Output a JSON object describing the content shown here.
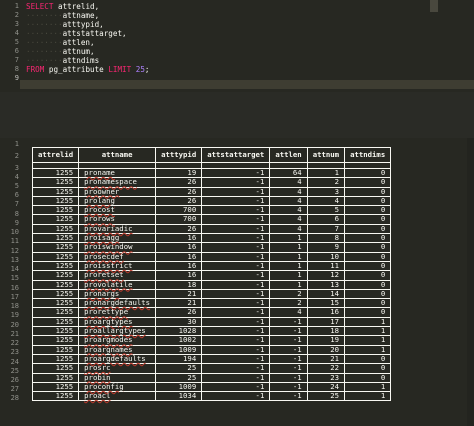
{
  "top_editor": {
    "line_numbers": [
      "1",
      "2",
      "3",
      "4",
      "5",
      "6",
      "7",
      "8",
      "9"
    ],
    "lines": [
      {
        "kw": "SELECT",
        "rest": " attrelid,"
      },
      {
        "rest": "attname,"
      },
      {
        "rest": "atttypid,"
      },
      {
        "rest": "attstattarget,"
      },
      {
        "rest": "attlen,"
      },
      {
        "rest": "attnum,"
      },
      {
        "rest": "attndims"
      },
      {
        "kw": "FROM",
        "rest": " pg_attribute ",
        "kw2": "LIMIT",
        "num": " 25",
        "end": ";"
      },
      {
        "rest": ""
      }
    ]
  },
  "bottom_editor": {
    "line_numbers": [
      "1",
      "2",
      "3",
      "4",
      "5",
      "6",
      "7",
      "8",
      "9",
      "10",
      "11",
      "12",
      "13",
      "14",
      "15",
      "16",
      "17",
      "18",
      "19",
      "20",
      "21",
      "22",
      "23",
      "24",
      "25",
      "26",
      "27",
      "28"
    ],
    "columns": [
      "attrelid",
      "attname",
      "atttypid",
      "attstattarget",
      "attlen",
      "attnum",
      "attndims"
    ],
    "rows": [
      [
        "1255",
        "proname",
        "19",
        "-1",
        "64",
        "1",
        "0"
      ],
      [
        "1255",
        "pronamespace",
        "26",
        "-1",
        "4",
        "2",
        "0"
      ],
      [
        "1255",
        "proowner",
        "26",
        "-1",
        "4",
        "3",
        "0"
      ],
      [
        "1255",
        "prolang",
        "26",
        "-1",
        "4",
        "4",
        "0"
      ],
      [
        "1255",
        "procost",
        "700",
        "-1",
        "4",
        "5",
        "0"
      ],
      [
        "1255",
        "prorows",
        "700",
        "-1",
        "4",
        "6",
        "0"
      ],
      [
        "1255",
        "provariadic",
        "26",
        "-1",
        "4",
        "7",
        "0"
      ],
      [
        "1255",
        "proisagg",
        "16",
        "-1",
        "1",
        "8",
        "0"
      ],
      [
        "1255",
        "proiswindow",
        "16",
        "-1",
        "1",
        "9",
        "0"
      ],
      [
        "1255",
        "prosecdef",
        "16",
        "-1",
        "1",
        "10",
        "0"
      ],
      [
        "1255",
        "proisstrict",
        "16",
        "-1",
        "1",
        "11",
        "0"
      ],
      [
        "1255",
        "proretset",
        "16",
        "-1",
        "1",
        "12",
        "0"
      ],
      [
        "1255",
        "provolatile",
        "18",
        "-1",
        "1",
        "13",
        "0"
      ],
      [
        "1255",
        "pronargs",
        "21",
        "-1",
        "2",
        "14",
        "0"
      ],
      [
        "1255",
        "pronargdefaults",
        "21",
        "-1",
        "2",
        "15",
        "0"
      ],
      [
        "1255",
        "prorettype",
        "26",
        "-1",
        "4",
        "16",
        "0"
      ],
      [
        "1255",
        "proargtypes",
        "30",
        "-1",
        "-1",
        "17",
        "1"
      ],
      [
        "1255",
        "proallargtypes",
        "1028",
        "-1",
        "-1",
        "18",
        "1"
      ],
      [
        "1255",
        "proargmodes",
        "1002",
        "-1",
        "-1",
        "19",
        "1"
      ],
      [
        "1255",
        "proargnames",
        "1009",
        "-1",
        "-1",
        "20",
        "1"
      ],
      [
        "1255",
        "proargdefaults",
        "194",
        "-1",
        "-1",
        "21",
        "0"
      ],
      [
        "1255",
        "prosrc",
        "25",
        "-1",
        "-1",
        "22",
        "0"
      ],
      [
        "1255",
        "probin",
        "25",
        "-1",
        "-1",
        "23",
        "0"
      ],
      [
        "1255",
        "proconfig",
        "1009",
        "-1",
        "-1",
        "24",
        "1"
      ],
      [
        "1255",
        "proacl",
        "1034",
        "-1",
        "-1",
        "25",
        "1"
      ]
    ]
  }
}
